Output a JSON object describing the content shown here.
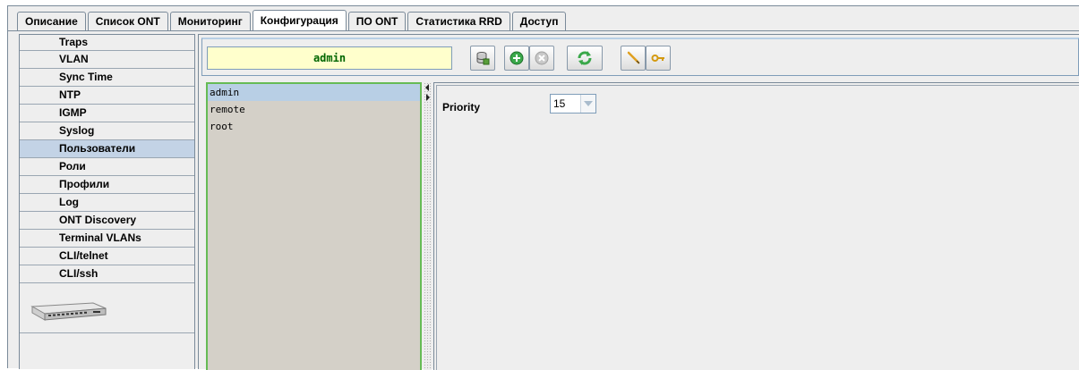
{
  "tabs": [
    {
      "label": "Описание",
      "active": false
    },
    {
      "label": "Список ONT",
      "active": false
    },
    {
      "label": "Мониторинг",
      "active": false
    },
    {
      "label": "Конфигурация",
      "active": true
    },
    {
      "label": "ПО ONT",
      "active": false
    },
    {
      "label": "Статистика RRD",
      "active": false
    },
    {
      "label": "Доступ",
      "active": false
    }
  ],
  "sidebar": {
    "items": [
      {
        "label": "Traps"
      },
      {
        "label": "VLAN"
      },
      {
        "label": "Sync Time"
      },
      {
        "label": "NTP"
      },
      {
        "label": "IGMP"
      },
      {
        "label": "Syslog"
      },
      {
        "label": "Пользователи",
        "selected": true
      },
      {
        "label": "Роли"
      },
      {
        "label": "Профили"
      },
      {
        "label": "Log"
      },
      {
        "label": "ONT Discovery"
      },
      {
        "label": "Terminal VLANs"
      },
      {
        "label": "CLI/telnet"
      },
      {
        "label": "CLI/ssh"
      }
    ],
    "device_icon": "olt-device-image"
  },
  "toolbar": {
    "name_value": "admin",
    "buttons": [
      {
        "icon": "database-icon"
      },
      {
        "icon": "add-icon"
      },
      {
        "icon": "remove-icon",
        "disabled": true
      },
      {
        "icon": "refresh-icon"
      },
      {
        "icon": "edit-pencil-icon"
      },
      {
        "icon": "key-icon"
      }
    ]
  },
  "users": {
    "items": [
      "admin",
      "remote",
      "root"
    ],
    "selected": "admin"
  },
  "properties": {
    "priority_label": "Priority",
    "priority_value": "15"
  },
  "colors": {
    "selection": "#c3d3e6",
    "list_border": "#66bb55",
    "name_field_bg": "#ffffcc",
    "name_text": "#006600"
  }
}
